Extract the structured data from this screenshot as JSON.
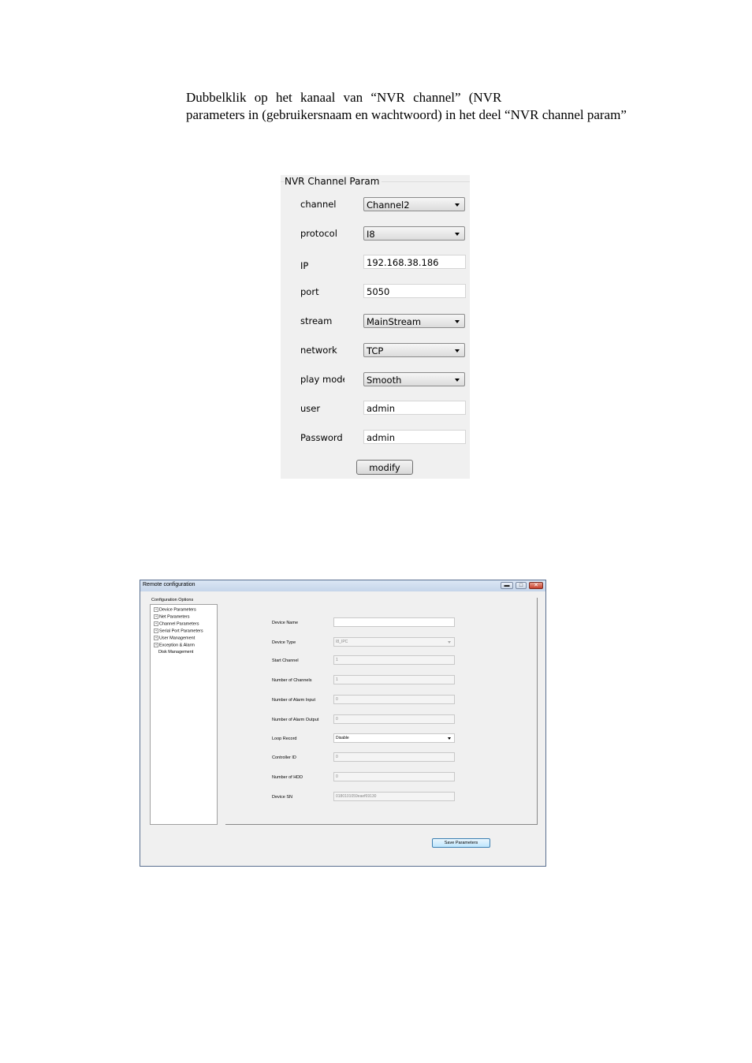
{
  "intro": {
    "line1": "Dubbelklik op het kanaal van “NVR channel” (NVR",
    "line2": "parameters in (gebruikersnaam en wachtwoord) in het deel “NVR channel param”"
  },
  "nvr_panel": {
    "title": "NVR Channel Param",
    "fields": {
      "channel": {
        "label": "channel",
        "value": "Channel2"
      },
      "protocol": {
        "label": "protocol",
        "value": "I8"
      },
      "ip": {
        "label": "IP",
        "value": "192.168.38.186"
      },
      "port": {
        "label": "port",
        "value": "5050"
      },
      "stream": {
        "label": "stream",
        "value": "MainStream"
      },
      "network": {
        "label": "network",
        "value": "TCP"
      },
      "play_mode": {
        "label": "play mode",
        "value": "Smooth"
      },
      "user": {
        "label": "user",
        "value": "admin"
      },
      "password": {
        "label": "Password",
        "value": "admin"
      }
    },
    "modify_label": "modify"
  },
  "remote_config": {
    "title": "Remote configuration",
    "tree_caption": "Configuration Options",
    "tree_items": [
      "Device Parameters",
      "Net Parameters",
      "Channel Parameters",
      "Serial Port Parameters",
      "User Management",
      "Exception & Alarm",
      "Disk Management"
    ],
    "form": {
      "device_name": {
        "label": "Device Name",
        "value": ""
      },
      "device_type": {
        "label": "Device Type",
        "value": "I8_IPC"
      },
      "start_channel": {
        "label": "Start Channel",
        "value": "1"
      },
      "num_channels": {
        "label": "Number of Channels",
        "value": "1"
      },
      "num_alarm_input": {
        "label": "Number of Alarm Input",
        "value": "0"
      },
      "num_alarm_output": {
        "label": "Number of Alarm Output",
        "value": "0"
      },
      "loop_record": {
        "label": "Loop Record",
        "value": "Disable"
      },
      "controller_id": {
        "label": "Controller ID",
        "value": "0"
      },
      "num_hdd": {
        "label": "Number of HDD",
        "value": "0"
      },
      "device_sn": {
        "label": "Device SN",
        "value": "0180101059eaef69130"
      }
    },
    "save_label": "Save Parameters"
  }
}
